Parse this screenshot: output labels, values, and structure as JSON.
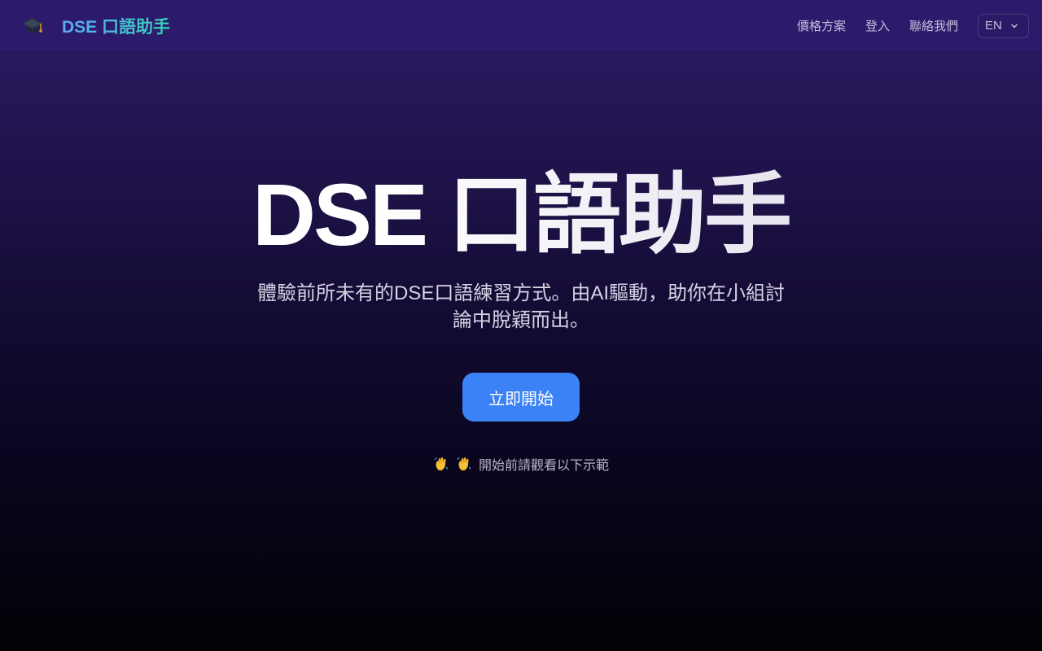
{
  "navbar": {
    "brand": {
      "icon": "graduation-cap-icon",
      "title": "DSE 口語助手"
    },
    "links": [
      "價格方案",
      "登入",
      "聯絡我們"
    ],
    "language": {
      "selected": "EN",
      "icon": "chevron-down-icon"
    }
  },
  "hero": {
    "title": "DSE 口語助手",
    "subtitle": "體驗前所未有的DSE口語練習方式。由AI驅動，助你在小組討論中脫穎而出。",
    "cta_label": "立即開始",
    "hint": {
      "icons": [
        "waving-hand-icon",
        "waving-hand-icon"
      ],
      "text": "開始前請觀看以下示範"
    }
  },
  "colors": {
    "accent": "#3b82f6",
    "brand_gradient_start": "#60a5fa",
    "brand_gradient_end": "#34d3b4",
    "navbar_bg": "#2c1a6c"
  }
}
